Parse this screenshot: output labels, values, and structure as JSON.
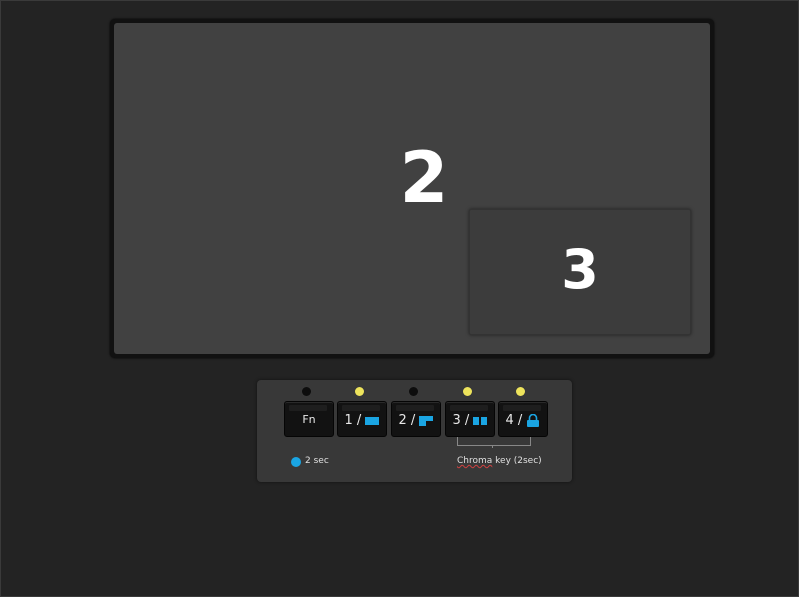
{
  "monitor": {
    "main_source": "2",
    "pip_source": "3"
  },
  "panel": {
    "leds": [
      "off",
      "on",
      "off",
      "on",
      "on"
    ],
    "keys": [
      {
        "label": "Fn",
        "icon": ""
      },
      {
        "label": "1 /",
        "icon": "full-screen-icon"
      },
      {
        "label": "2 /",
        "icon": "pip-top-left-icon"
      },
      {
        "label": "3 /",
        "icon": "side-by-side-icon"
      },
      {
        "label": "4 /",
        "icon": "lock-icon"
      }
    ],
    "legend_text": "2 sec",
    "chroma_word": "Chroma",
    "chroma_rest": " key (2sec)"
  },
  "colors": {
    "accent": "#1aa5e3",
    "led_on": "#eee45c",
    "led_off": "#0d0d0d"
  }
}
